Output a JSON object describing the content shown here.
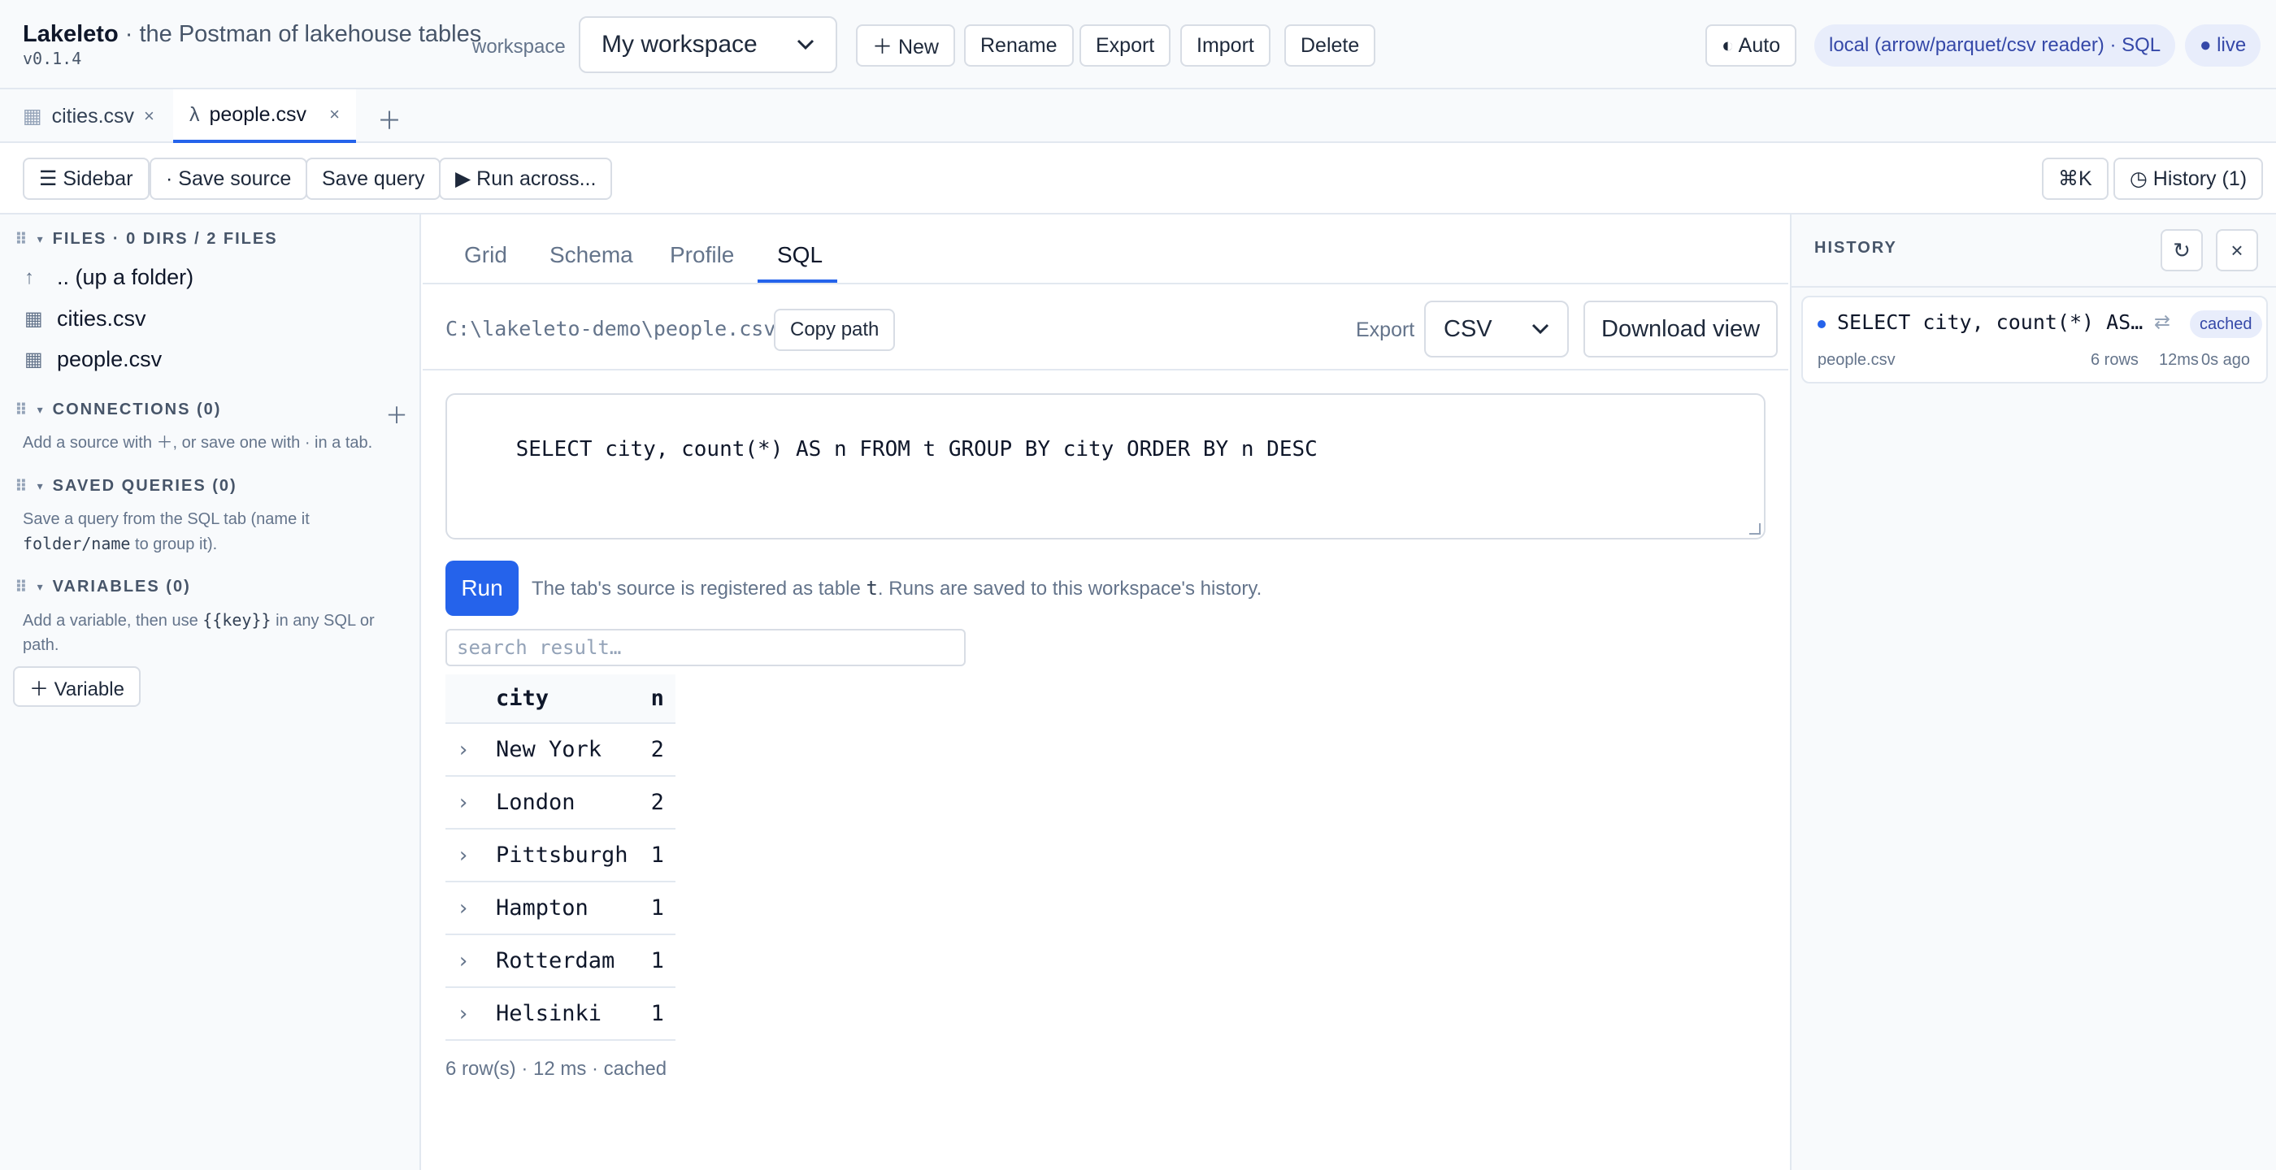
{
  "header": {
    "app_name": "Lakeleto",
    "tagline": "· the Postman of lakehouse tables",
    "version": "v0.1.4",
    "workspace_label": "workspace",
    "workspace_value": "My workspace",
    "buttons": {
      "new": "＋ New",
      "rename": "Rename",
      "export": "Export",
      "import": "Import",
      "delete": "Delete"
    },
    "theme_button": "◐ Auto",
    "reader_pill": "local (arrow/parquet/csv reader) · SQL",
    "live_pill": "● live"
  },
  "file_tabs": [
    {
      "icon": "▦",
      "label": "cities.csv",
      "close": "×"
    },
    {
      "icon": "λ",
      "label": "people.csv",
      "close": "×"
    }
  ],
  "file_tabs_add": "＋",
  "toolbar": {
    "sidebar": "☰ Sidebar",
    "save_source": "· Save source",
    "save_query": "Save query",
    "run_across": "▶ Run across...",
    "cmdk": "⌘K",
    "history": "◷ History (1)"
  },
  "sidebar": {
    "files_header": "FILES · 0 DIRS / 2 FILES",
    "files": [
      {
        "icon": "↑",
        "label": ".. (up a folder)"
      },
      {
        "icon": "▦",
        "label": "cities.csv"
      },
      {
        "icon": "▦",
        "label": "people.csv"
      }
    ],
    "connections_header": "CONNECTIONS (0)",
    "connections_add": "＋",
    "connections_hint": "Add a source with ＋, or save one with · in a tab.",
    "saved_header": "SAVED QUERIES (0)",
    "saved_hint_1": "Save a query from the SQL tab (name it",
    "saved_hint_code": "folder/name",
    "saved_hint_2": "to group it).",
    "variables_header": "VARIABLES (0)",
    "variables_hint_1": "Add a variable, then use",
    "variables_hint_code": "{{key}}",
    "variables_hint_2": "in any SQL or path.",
    "variable_button": "＋ Variable",
    "grip": "⠿",
    "caret": "▾"
  },
  "main": {
    "view_tabs": [
      "Grid",
      "Schema",
      "Profile",
      "SQL"
    ],
    "active_tab": "SQL",
    "path": "C:\\lakeleto-demo\\people.csv",
    "copy_path": "Copy path",
    "export_label": "Export",
    "export_format": "CSV",
    "download_view": "Download view",
    "sql": "SELECT city, count(*) AS n FROM t GROUP BY city ORDER BY n DESC",
    "run": "Run",
    "run_note_1": "The tab's source is registered as table",
    "run_note_code": "t",
    "run_note_2": ". Runs are saved to this workspace's history.",
    "search_placeholder": "search result…",
    "result": {
      "columns": [
        "city",
        "n"
      ],
      "rows": [
        [
          "New York",
          "2"
        ],
        [
          "London",
          "2"
        ],
        [
          "Pittsburgh",
          "1"
        ],
        [
          "Hampton",
          "1"
        ],
        [
          "Rotterdam",
          "1"
        ],
        [
          "Helsinki",
          "1"
        ]
      ],
      "expand_icon": "›"
    },
    "footer": "6 row(s) · 12 ms · cached"
  },
  "history": {
    "title": "HISTORY",
    "refresh": "↻",
    "close": "×",
    "entries": [
      {
        "query": "SELECT city, count(*) AS n FROM t GROUP BY city ORDER BY n DESC",
        "swap_icon": "⇄",
        "badge": "cached",
        "source": "people.csv",
        "rows": "6 rows",
        "ms": "12ms",
        "ago": "0s ago"
      }
    ]
  },
  "colors": {
    "accent": "#2563eb",
    "pill_bg": "#e8edfb",
    "pill_text": "#3548a8"
  }
}
